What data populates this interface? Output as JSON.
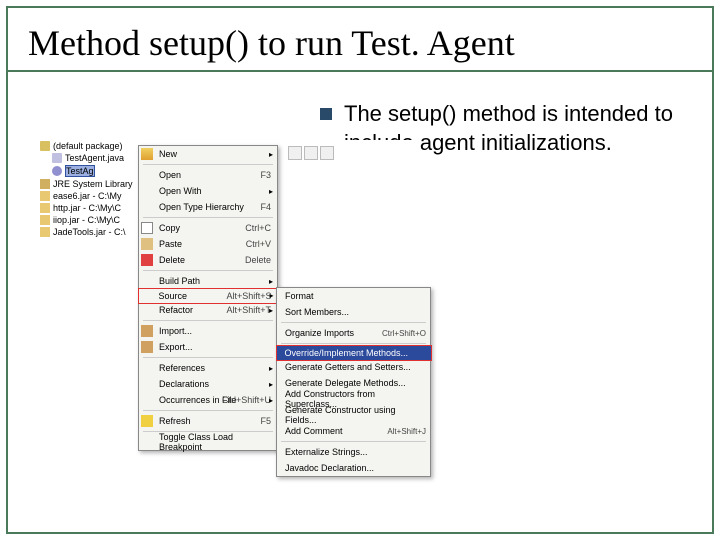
{
  "title": "Method setup() to run Test. Agent",
  "bullet_text": "The setup() method is intended to include agent initializations.",
  "tree": {
    "pkg": "(default package)",
    "java": "TestAgent.java",
    "class": "TestAg",
    "lib": "JRE System Library",
    "jar1": "ease6.jar - C:\\My",
    "jar2": "http.jar - C:\\My\\C",
    "jar3": "iiop.jar - C:\\My\\C",
    "jar4": "JadeTools.jar - C:\\"
  },
  "menu1": {
    "new": "New",
    "open": "Open",
    "open_sc": "F3",
    "openwith": "Open With",
    "openhier": "Open Type Hierarchy",
    "openhier_sc": "F4",
    "copy": "Copy",
    "copy_sc": "Ctrl+C",
    "paste": "Paste",
    "paste_sc": "Ctrl+V",
    "delete": "Delete",
    "delete_sc": "Delete",
    "buildpath": "Build Path",
    "source": "Source",
    "source_sc": "Alt+Shift+S",
    "refactor": "Refactor",
    "refactor_sc": "Alt+Shift+T",
    "import": "Import...",
    "export": "Export...",
    "references": "References",
    "declarations": "Declarations",
    "occurrences": "Occurrences in File",
    "occurrences_sc": "Ctrl+Shift+U",
    "refresh": "Refresh",
    "refresh_sc": "F5",
    "toggle": "Toggle Class Load Breakpoint"
  },
  "menu2": {
    "format": "Format",
    "sort": "Sort Members...",
    "organize": "Organize Imports",
    "organize_sc": "Ctrl+Shift+O",
    "override": "Override/Implement Methods...",
    "getset": "Generate Getters and Setters...",
    "delegate": "Generate Delegate Methods...",
    "addsuper": "Add Constructors from Superclass...",
    "genconstr": "Generate Constructor using Fields...",
    "addcomment": "Add Comment",
    "addcomment_sc": "Alt+Shift+J",
    "externalize": "Externalize Strings...",
    "javadoc": "Javadoc Declaration..."
  }
}
